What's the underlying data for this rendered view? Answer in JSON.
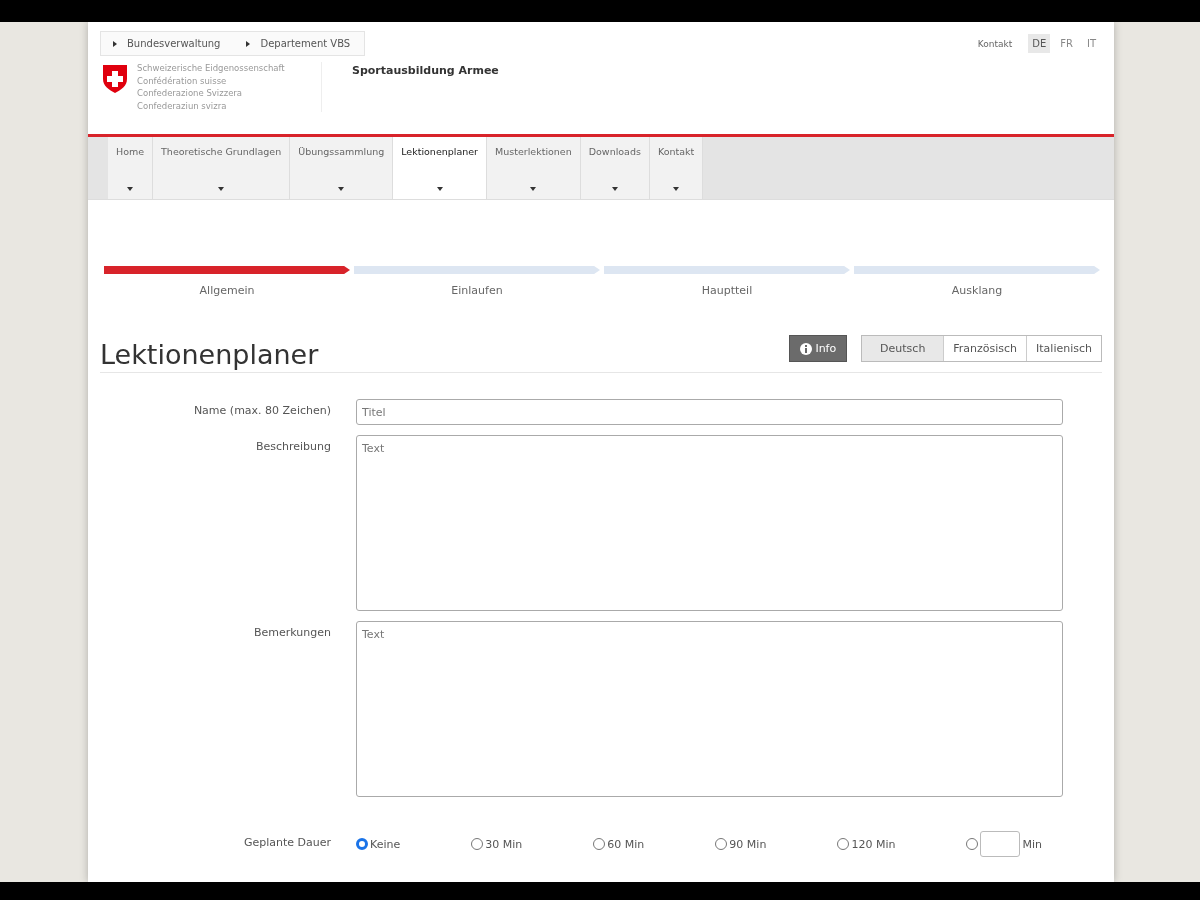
{
  "breadcrumb": [
    "Bundesverwaltung",
    "Departement VBS"
  ],
  "meta_links": {
    "contact": "Kontakt",
    "languages": [
      {
        "label": "DE",
        "selected": true
      },
      {
        "label": "FR",
        "selected": false
      },
      {
        "label": "IT",
        "selected": false
      }
    ]
  },
  "logo_lines": [
    "Schweizerische Eidgenossenschaft",
    "Confédération suisse",
    "Confederazione Svizzera",
    "Confederaziun svizra"
  ],
  "site_title": "Sportausbildung Armee",
  "nav": [
    {
      "label": "Home",
      "selected": false
    },
    {
      "label": "Theoretische Grundlagen",
      "selected": false
    },
    {
      "label": "Übungssammlung",
      "selected": false
    },
    {
      "label": "Lektionenplaner",
      "selected": true
    },
    {
      "label": "Musterlektionen",
      "selected": false
    },
    {
      "label": "Downloads",
      "selected": false
    },
    {
      "label": "Kontakt",
      "selected": false
    }
  ],
  "steps": [
    {
      "label": "Allgemein",
      "selected": true
    },
    {
      "label": "Einlaufen",
      "selected": false
    },
    {
      "label": "Hauptteil",
      "selected": false
    },
    {
      "label": "Ausklang",
      "selected": false
    }
  ],
  "page_title": "Lektionenplaner",
  "info_button": "Info",
  "language_tabs": [
    {
      "label": "Deutsch",
      "selected": true
    },
    {
      "label": "Französisch",
      "selected": false
    },
    {
      "label": "Italienisch",
      "selected": false
    }
  ],
  "fields": [
    {
      "label": "Name (max. 80 Zeichen)",
      "kind": "input",
      "placeholder": "Titel"
    },
    {
      "label": "Beschreibung",
      "kind": "textarea",
      "placeholder": "Text"
    },
    {
      "label": "Bemerkungen",
      "kind": "textarea",
      "placeholder": "Text"
    }
  ],
  "duration": {
    "label": "Geplante Dauer",
    "options": [
      {
        "label": "Keine",
        "selected": true
      },
      {
        "label": "30 Min",
        "selected": false
      },
      {
        "label": "60 Min",
        "selected": false
      },
      {
        "label": "90 Min",
        "selected": false
      },
      {
        "label": "120 Min",
        "selected": false
      }
    ],
    "custom": {
      "selected": false,
      "unit": "Min"
    }
  }
}
